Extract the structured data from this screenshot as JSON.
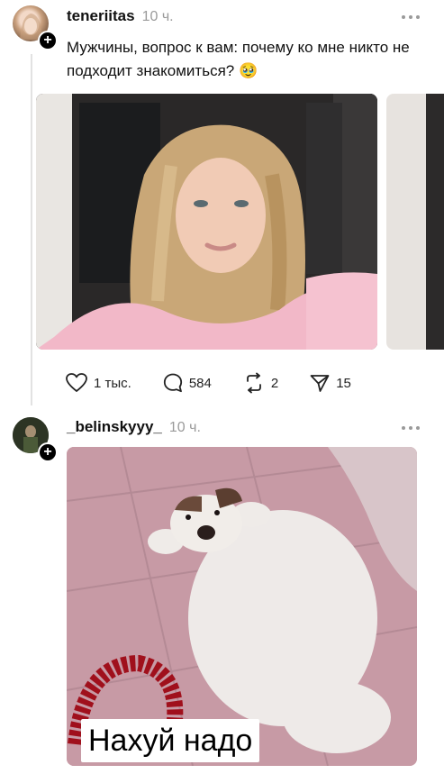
{
  "posts": [
    {
      "username": "teneriitas",
      "time": "10 ч.",
      "caption": "Мужчины, вопрос к вам: почему ко мне никто не подходит знакомиться? 🥹",
      "more_icon": "more-horizontal-icon",
      "actions": {
        "likes": "1 тыс.",
        "comments": "584",
        "reposts": "2",
        "shares": "15"
      }
    },
    {
      "username": "_belinskyyy_",
      "time": "10 ч.",
      "more_icon": "more-horizontal-icon",
      "image_caption": "Нахуй надо"
    }
  ],
  "colors": {
    "text": "#111111",
    "muted": "#9a9a9a",
    "thread_line": "#e2e2e2",
    "badge": "#000000"
  },
  "icons": [
    "plus-icon",
    "heart-icon",
    "comment-icon",
    "repost-icon",
    "share-icon",
    "more-horizontal-icon"
  ]
}
